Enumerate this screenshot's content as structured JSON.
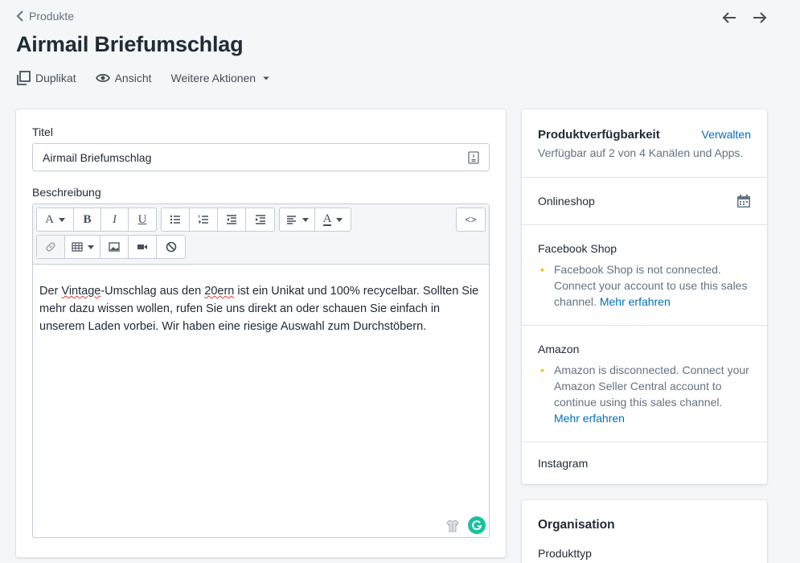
{
  "breadcrumb": {
    "label": "Produkte"
  },
  "page": {
    "title": "Airmail Briefumschlag"
  },
  "actions": {
    "duplicate": "Duplikat",
    "view": "Ansicht",
    "more": "Weitere Aktionen"
  },
  "form": {
    "title_label": "Titel",
    "title_value": "Airmail Briefumschlag",
    "description_label": "Beschreibung",
    "description": {
      "p1": "Der ",
      "w1": "Vintage",
      "p2": "-Umschlag aus den ",
      "w2": "20ern",
      "p3": " ist ein Unikat und 100% recycelbar. Sollten Sie mehr dazu wissen wollen, rufen Sie uns direkt an oder schauen Sie einfach in unserem Laden vorbei. Wir haben eine riesige Auswahl zum Durchstöbern."
    }
  },
  "toolbar": {
    "font": "A",
    "bold": "B",
    "italic": "I",
    "underline": "U",
    "color": "A",
    "code": "<>"
  },
  "availability": {
    "title": "Produktverfügbarkeit",
    "manage": "Verwalten",
    "summary": "Verfügbar auf 2 von 4 Kanälen und Apps.",
    "channels": {
      "online": "Onlineshop",
      "facebook": {
        "name": "Facebook Shop",
        "message": "Facebook Shop is not connected. Connect your account to use this sales channel.",
        "link": "Mehr erfahren"
      },
      "amazon": {
        "name": "Amazon",
        "message": "Amazon is disconnected. Connect your Amazon Seller Central account to continue using this sales channel.",
        "link": "Mehr erfahren"
      },
      "instagram": "Instagram"
    }
  },
  "organization": {
    "title": "Organisation",
    "product_type": "Produkttyp"
  }
}
